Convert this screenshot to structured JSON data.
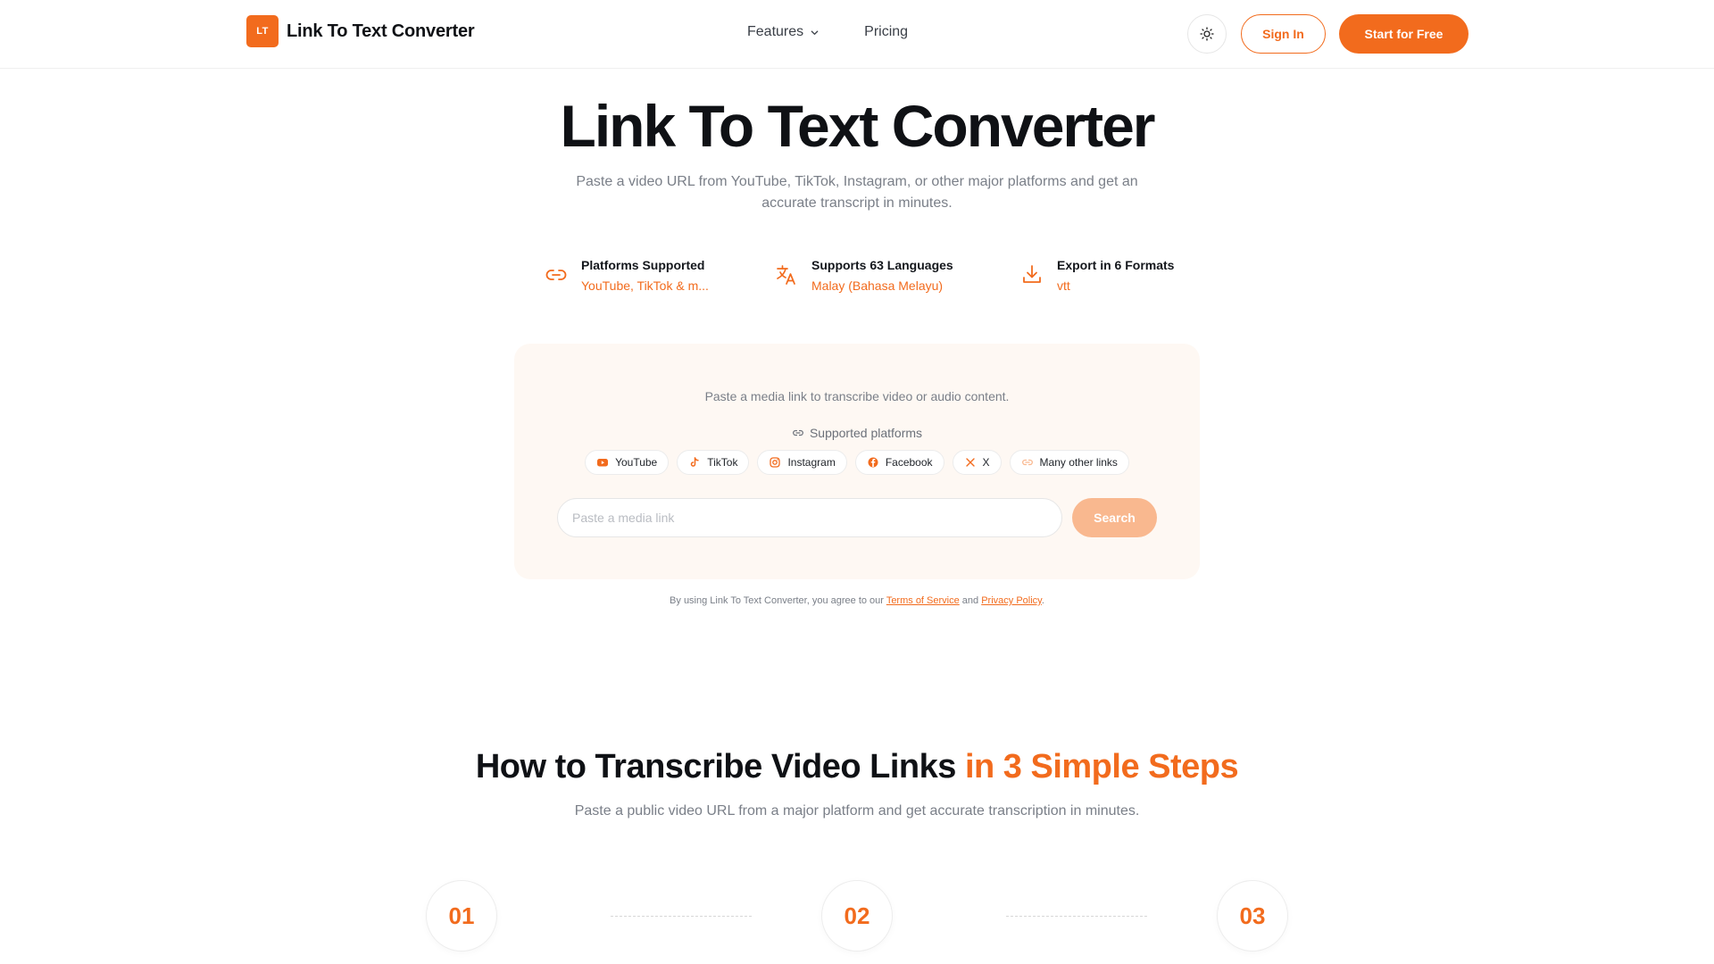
{
  "header": {
    "logo_mark": "LT",
    "logo_text": "Link To Text Converter",
    "nav": [
      {
        "label": "Features",
        "has_dropdown": true
      },
      {
        "label": "Pricing",
        "has_dropdown": false
      }
    ],
    "theme_icon": "sun-icon",
    "signin_label": "Sign In",
    "start_label": "Start for Free"
  },
  "hero": {
    "title": "Link To Text Converter",
    "subtitle": "Paste a video URL from YouTube, TikTok, Instagram, or other major platforms and get an accurate transcript in minutes."
  },
  "features": [
    {
      "icon": "link-icon",
      "title": "Platforms Supported",
      "value": "YouTube, TikTok & m..."
    },
    {
      "icon": "translate-icon",
      "title": "Supports 63 Languages",
      "value": "Malay (Bahasa Melayu)"
    },
    {
      "icon": "download-icon",
      "title": "Export in 6 Formats",
      "value": "vtt"
    }
  ],
  "card": {
    "hint": "Paste a media link to transcribe video or audio content.",
    "supported_label": "Supported platforms",
    "platforms": [
      {
        "label": "YouTube",
        "icon": "youtube-icon"
      },
      {
        "label": "TikTok",
        "icon": "tiktok-icon"
      },
      {
        "label": "Instagram",
        "icon": "instagram-icon"
      },
      {
        "label": "Facebook",
        "icon": "facebook-icon"
      },
      {
        "label": "X",
        "icon": "x-icon"
      },
      {
        "label": "Many other links",
        "icon": "links-icon"
      }
    ],
    "input_placeholder": "Paste a media link",
    "input_value": "",
    "search_label": "Search"
  },
  "legal": {
    "prefix": "By using Link To Text Converter, you agree to our",
    "terms": "Terms of Service",
    "and": "and",
    "privacy": "Privacy Policy",
    "suffix": "."
  },
  "how": {
    "title_main": "How to Transcribe Video Links",
    "title_accent": "in 3 Simple Steps",
    "subtitle": "Paste a public video URL from a major platform and get accurate transcription in minutes.",
    "steps": [
      "01",
      "02",
      "03"
    ]
  },
  "colors": {
    "accent": "#f26b1d",
    "accent_light": "#f9b88f",
    "card_bg": "#fef8f3"
  }
}
